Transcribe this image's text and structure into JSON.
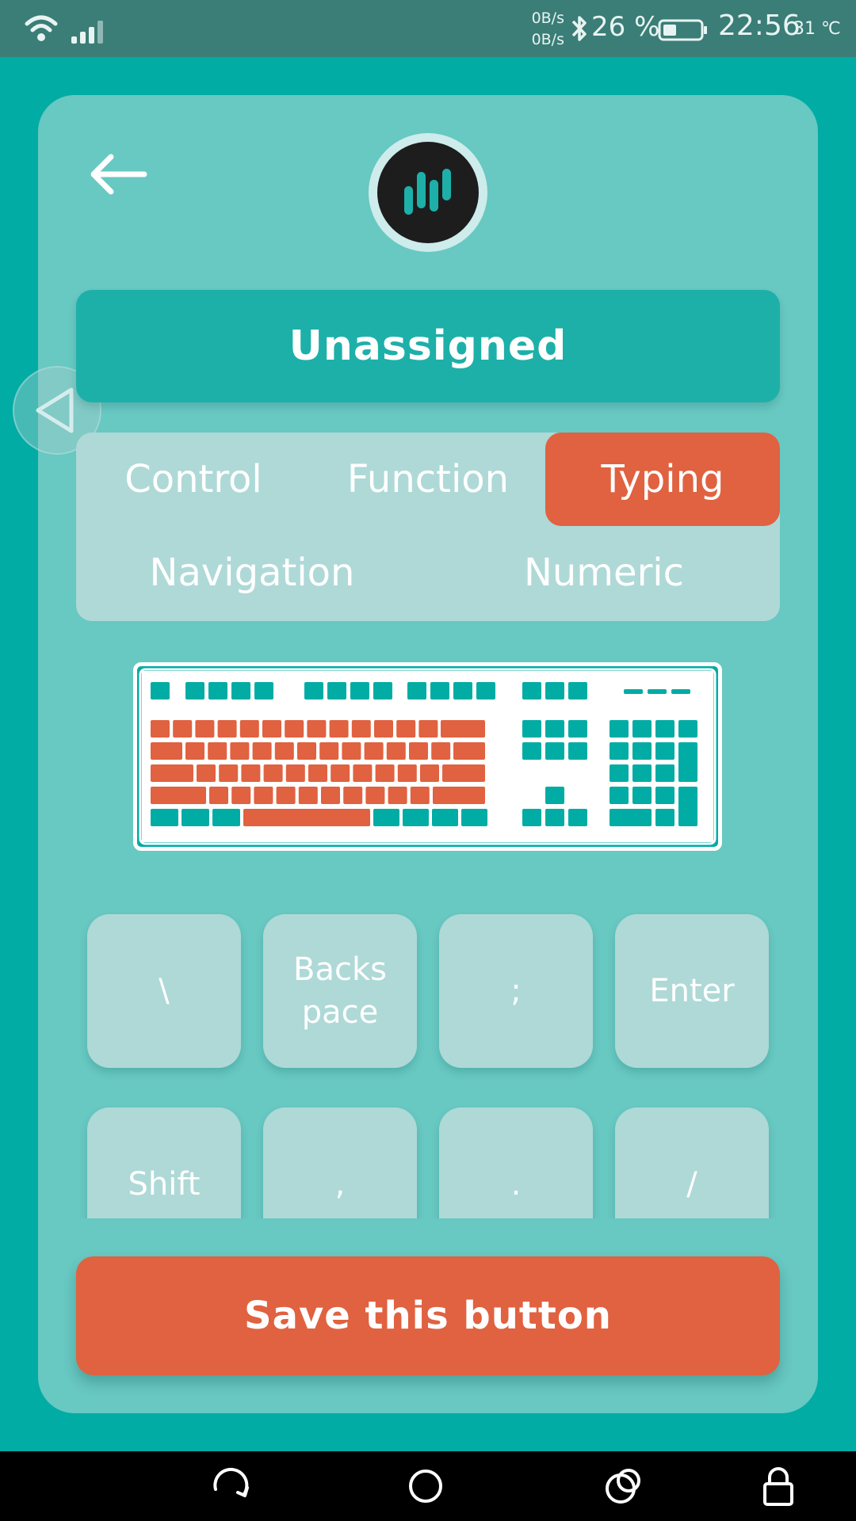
{
  "status_bar": {
    "net_up": "0B/s",
    "net_down": "0B/s",
    "battery_percent": "26 %",
    "time": "22:56",
    "temperature": "31 ℃",
    "icons": [
      "wifi-icon",
      "signal-icon",
      "bluetooth-icon",
      "battery-icon"
    ]
  },
  "header": {
    "back_icon": "arrow-left-icon",
    "logo_icon": "app-logo-icon"
  },
  "assigned_key_title": "Unassigned",
  "categories": [
    {
      "label": "Control",
      "active": false
    },
    {
      "label": "Function",
      "active": false
    },
    {
      "label": "Typing",
      "active": true
    },
    {
      "label": "Navigation",
      "active": false
    },
    {
      "label": "Numeric",
      "active": false
    }
  ],
  "keyboard_illustration": {
    "highlighted_section": "typing",
    "colors": {
      "base": "#00aca4",
      "highlight": "#e06240",
      "outline": "#ffffff"
    }
  },
  "keys": [
    "\\",
    "Backspace",
    ";",
    "Enter",
    "Shift",
    ",",
    ".",
    "/"
  ],
  "save_button": "Save this button",
  "nav_bar": {
    "icons": [
      "rotate-icon",
      "home-icon",
      "recents-icon",
      "lock-icon"
    ]
  },
  "colors": {
    "background": "#00aca4",
    "card": "#68c8c2",
    "accent": "#e06240",
    "title_bar": "#1db0a9",
    "panel": "#aed9d7"
  }
}
